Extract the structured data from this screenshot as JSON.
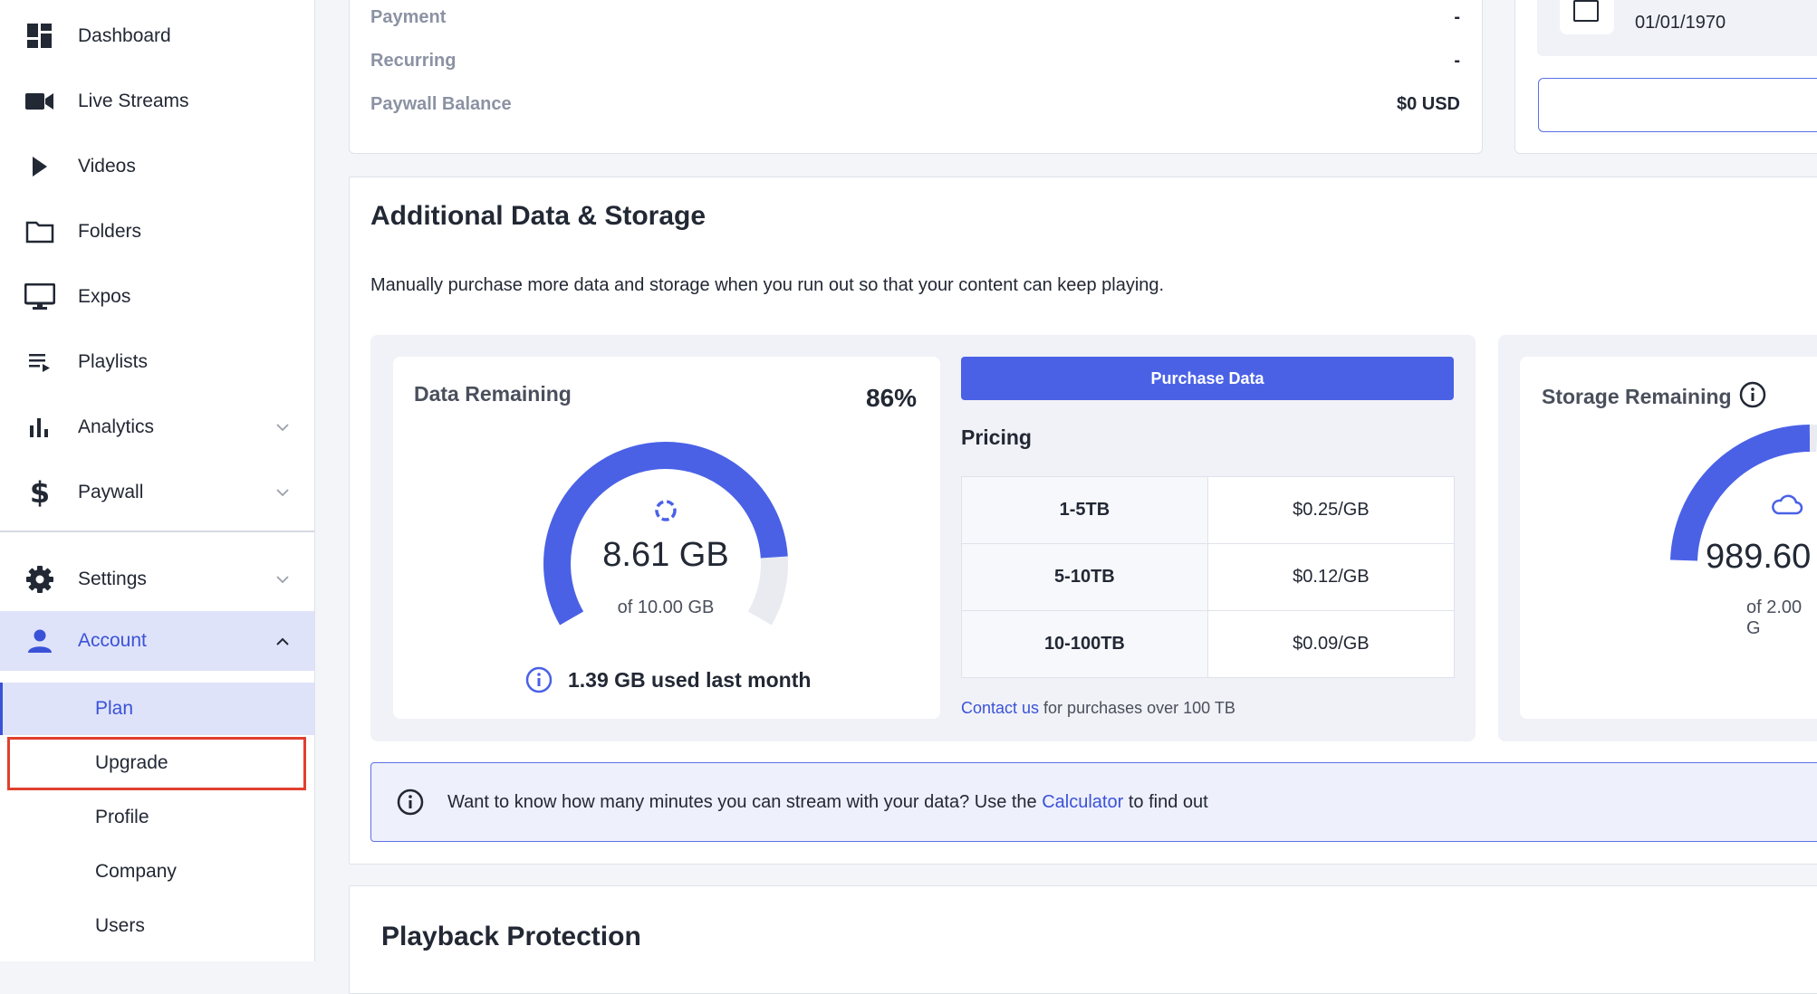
{
  "sidebar": {
    "items": [
      {
        "label": "Dashboard",
        "icon": "dashboard-icon"
      },
      {
        "label": "Live Streams",
        "icon": "video-camera-icon"
      },
      {
        "label": "Videos",
        "icon": "play-icon"
      },
      {
        "label": "Folders",
        "icon": "folder-icon"
      },
      {
        "label": "Expos",
        "icon": "monitor-icon"
      },
      {
        "label": "Playlists",
        "icon": "playlist-icon"
      },
      {
        "label": "Analytics",
        "icon": "bar-chart-icon"
      },
      {
        "label": "Paywall",
        "icon": "dollar-icon"
      },
      {
        "label": "Settings",
        "icon": "gear-icon"
      },
      {
        "label": "Account",
        "icon": "user-icon"
      }
    ],
    "account_sub": [
      {
        "label": "Plan"
      },
      {
        "label": "Upgrade"
      },
      {
        "label": "Profile"
      },
      {
        "label": "Company"
      },
      {
        "label": "Users"
      }
    ]
  },
  "billing": {
    "rows": [
      {
        "label": "Payment",
        "value": "-"
      },
      {
        "label": "Recurring",
        "value": "-"
      },
      {
        "label": "Paywall Balance",
        "value": "$0 USD"
      }
    ],
    "date": "01/01/1970"
  },
  "data_storage": {
    "title": "Additional Data & Storage",
    "description": "Manually purchase more data and storage when you run out so that your content can keep playing.",
    "data": {
      "title": "Data Remaining",
      "percent_label": "86%",
      "percent": 0.86,
      "remaining": "8.61 GB",
      "total": "of 10.00 GB",
      "used_last_month": "1.39 GB used last month"
    },
    "purchase_button": "Purchase Data",
    "pricing_title": "Pricing",
    "pricing": [
      {
        "tier": "1-5TB",
        "price": "$0.25/GB"
      },
      {
        "tier": "5-10TB",
        "price": "$0.12/GB"
      },
      {
        "tier": "10-100TB",
        "price": "$0.09/GB"
      }
    ],
    "contact_link": "Contact us",
    "contact_text": " for purchases over 100 TB",
    "storage": {
      "title": "Storage Remaining",
      "remaining": "989.60",
      "total": "of 2.00 G"
    }
  },
  "banner": {
    "text_before": "Want to know how many minutes you can stream with your data? Use the ",
    "link": "Calculator",
    "text_after": " to find out"
  },
  "playback": {
    "title": "Playback Protection"
  },
  "colors": {
    "accent": "#4a61e6",
    "highlight": "#e0402e",
    "active_bg": "#dfe3f9"
  }
}
